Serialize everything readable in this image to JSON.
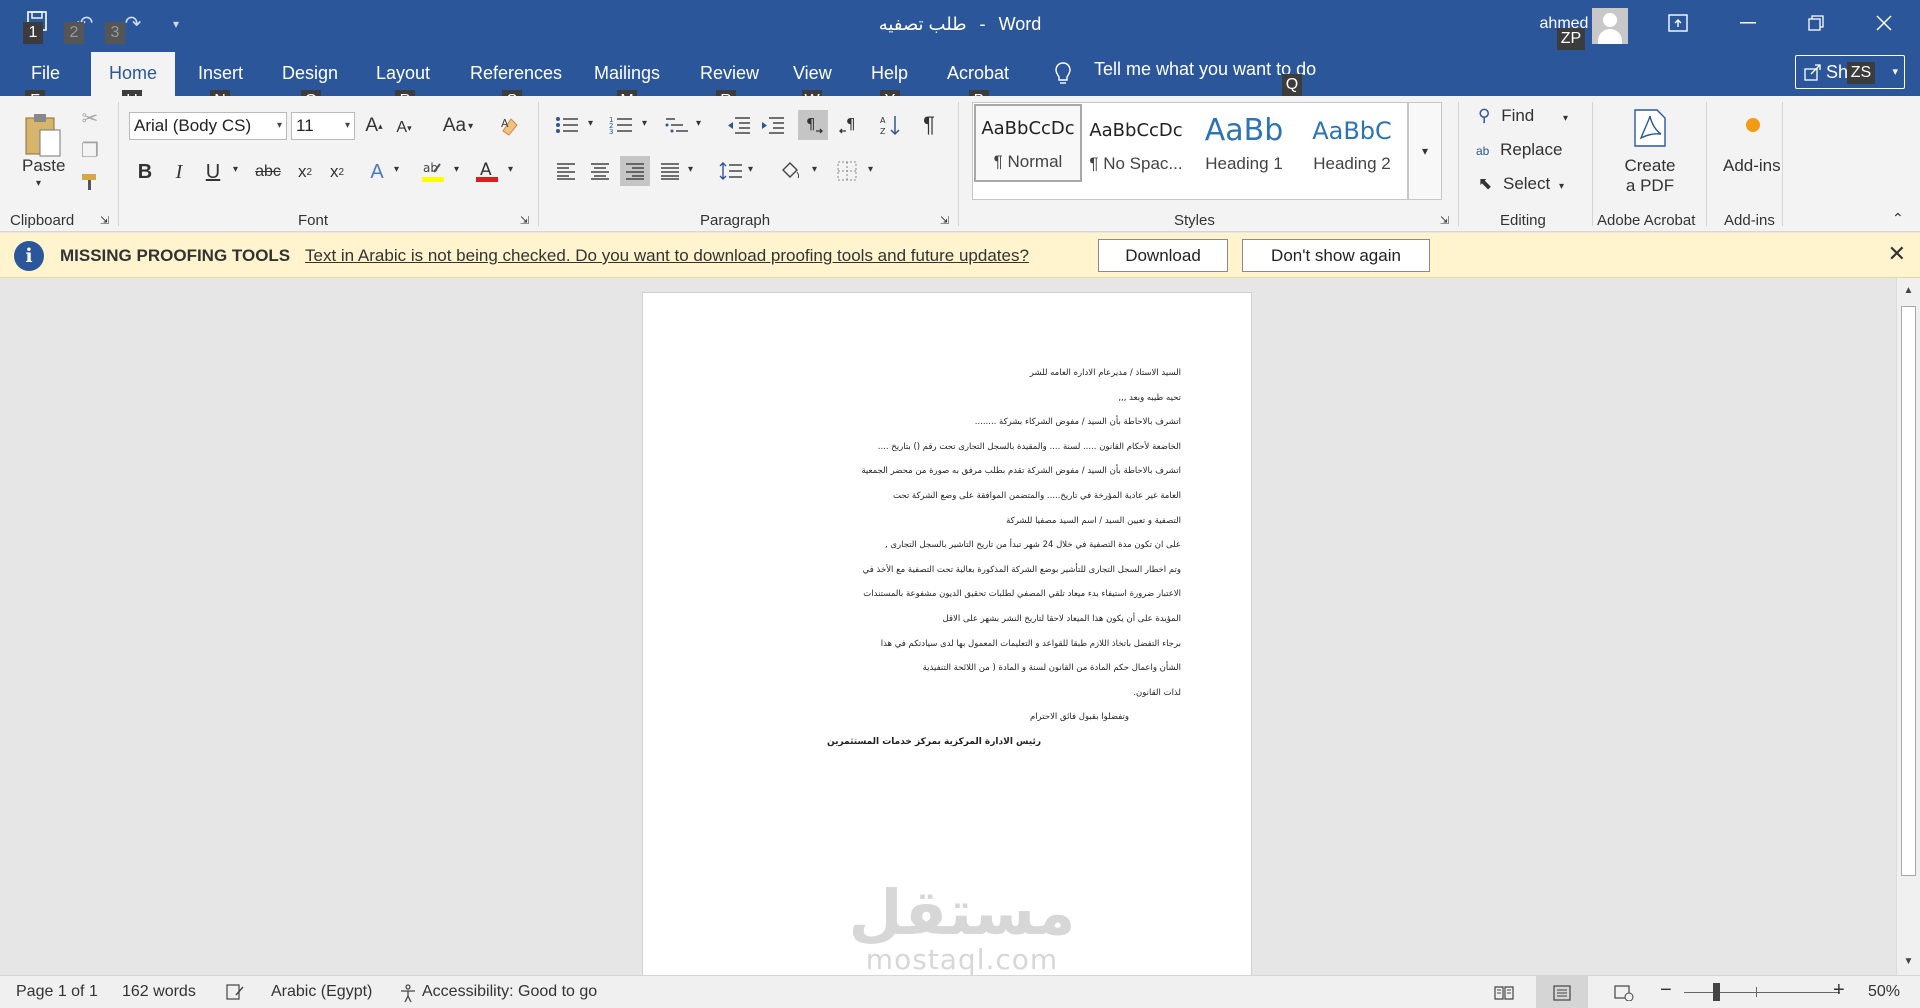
{
  "window": {
    "app_name": "Word",
    "doc_name": "طلب تصفيه",
    "separator": "-",
    "user": "ahmed amir",
    "controls": {
      "ribbon_display": "⊡",
      "minimize": "—",
      "restore": "❐",
      "close": "✕"
    }
  },
  "qat": [
    "save-icon",
    "undo-icon",
    "redo-icon",
    "customize-icon"
  ],
  "tabs": [
    {
      "label": "File"
    },
    {
      "label": "Home"
    },
    {
      "label": "Insert"
    },
    {
      "label": "Design"
    },
    {
      "label": "Layout"
    },
    {
      "label": "References"
    },
    {
      "label": "Mailings"
    },
    {
      "label": "Review"
    },
    {
      "label": "View"
    },
    {
      "label": "Help"
    },
    {
      "label": "Acrobat"
    }
  ],
  "tell_me": "Tell me what you want to do",
  "share_label": "Share",
  "keytips": {
    "qat_1": "1",
    "qat_2": "2",
    "qat_3": "3",
    "account": "ZP",
    "share": "ZS",
    "tell": "Q",
    "file": "F",
    "home": "H",
    "insert": "N",
    "design": "G",
    "layout": "P",
    "references": "S",
    "mailings": "M",
    "review": "R",
    "view": "W",
    "help": "Y",
    "acrobat": "B"
  },
  "ribbon": {
    "clipboard": {
      "label": "Clipboard",
      "paste": "Paste"
    },
    "font": {
      "label": "Font",
      "font_name": "Arial (Body CS)",
      "font_size": "11",
      "change_case": "Aa"
    },
    "paragraph": {
      "label": "Paragraph"
    },
    "styles": {
      "label": "Styles",
      "items": [
        {
          "preview": "AaBbCcDc",
          "name": "¶ Normal"
        },
        {
          "preview": "AaBbCcDc",
          "name": "¶ No Spac..."
        },
        {
          "preview": "AaBb",
          "name": "Heading 1"
        },
        {
          "preview": "AaBbC",
          "name": "Heading 2"
        }
      ]
    },
    "editing": {
      "label": "Editing",
      "find": "Find",
      "replace": "Replace",
      "select": "Select"
    },
    "acrobat": {
      "label": "Adobe Acrobat",
      "create_pdf_1": "Create",
      "create_pdf_2": "a PDF"
    },
    "addins": {
      "label": "Add-ins",
      "button": "Add-ins"
    }
  },
  "message_bar": {
    "title": "MISSING PROOFING TOOLS",
    "text": "Text in Arabic is not being checked. Do you want to download proofing tools and future updates?",
    "download": "Download",
    "dont_show": "Don't show again"
  },
  "document": {
    "lines": [
      "السيد الاستاذ / مديرعام الاداره العامه للشر",
      "تحيه طيبه وبعد ,,,",
      "اتشرف بالاحاطة بأن السيد / مفوض الشركاء بشركة ........",
      "الخاضعة لأحكام القانون ..... لسنة .... والمقيدة بالسجل التجارى تحت رقم () بتاريخ ....",
      "اتشرف بالاحاطة بأن السيد / مفوض الشركة تقدم بطلب مرفق به صورة من محضر الجمعية",
      "العامة غير عادية المؤرخة في تاريخ..... والمتضمن الموافقة على وضع الشركة تحت",
      "التصفية و تعيين السيد / اسم السيد مصفيا للشركة",
      "على ان تكون مدة التصفية في خلال 24 شهر تبدأ من تاريخ التاشير بالسجل التجارى ,",
      "وتم اخطار السجل التجارى للتأشير بوضع الشركة المذكورة بعالية تحت التصفية مع الأخذ في",
      "الاعتبار ضرورة استيفاء بدء ميعاد تلقي المصفي لطلبات تحقيق الديون مشفوعة بالمستندات",
      "المؤيدة على أن يكون هذا الميعاد لاحقا لتاريخ النشر بشهر على الاقل",
      "برجاء التفضل باتخاذ اللازم طبقا للقواعد و التعليمات المعمول بها لدى سيادتكم في هذا",
      "الشأن واعمال حكم المادة من القانون لسنة و المادة ( من اللائحة التنفيذية",
      "لذات القانون.",
      "وتفضلوا بقبول فائق الاحترام",
      "رئيس الادارة المركزية بمركز خدمات المستثمرين"
    ]
  },
  "watermark": {
    "arabic": "مستقل",
    "latin": "mostaql.com"
  },
  "status": {
    "page": "Page 1 of 1",
    "words": "162 words",
    "language": "Arabic (Egypt)",
    "accessibility": "Accessibility: Good to go",
    "zoom": "50%"
  },
  "zoom_level_percent": 50,
  "colors": {
    "accent": "#2b579a",
    "message_bar_bg": "#fff4ce",
    "addin_dot": "#f39c12"
  }
}
